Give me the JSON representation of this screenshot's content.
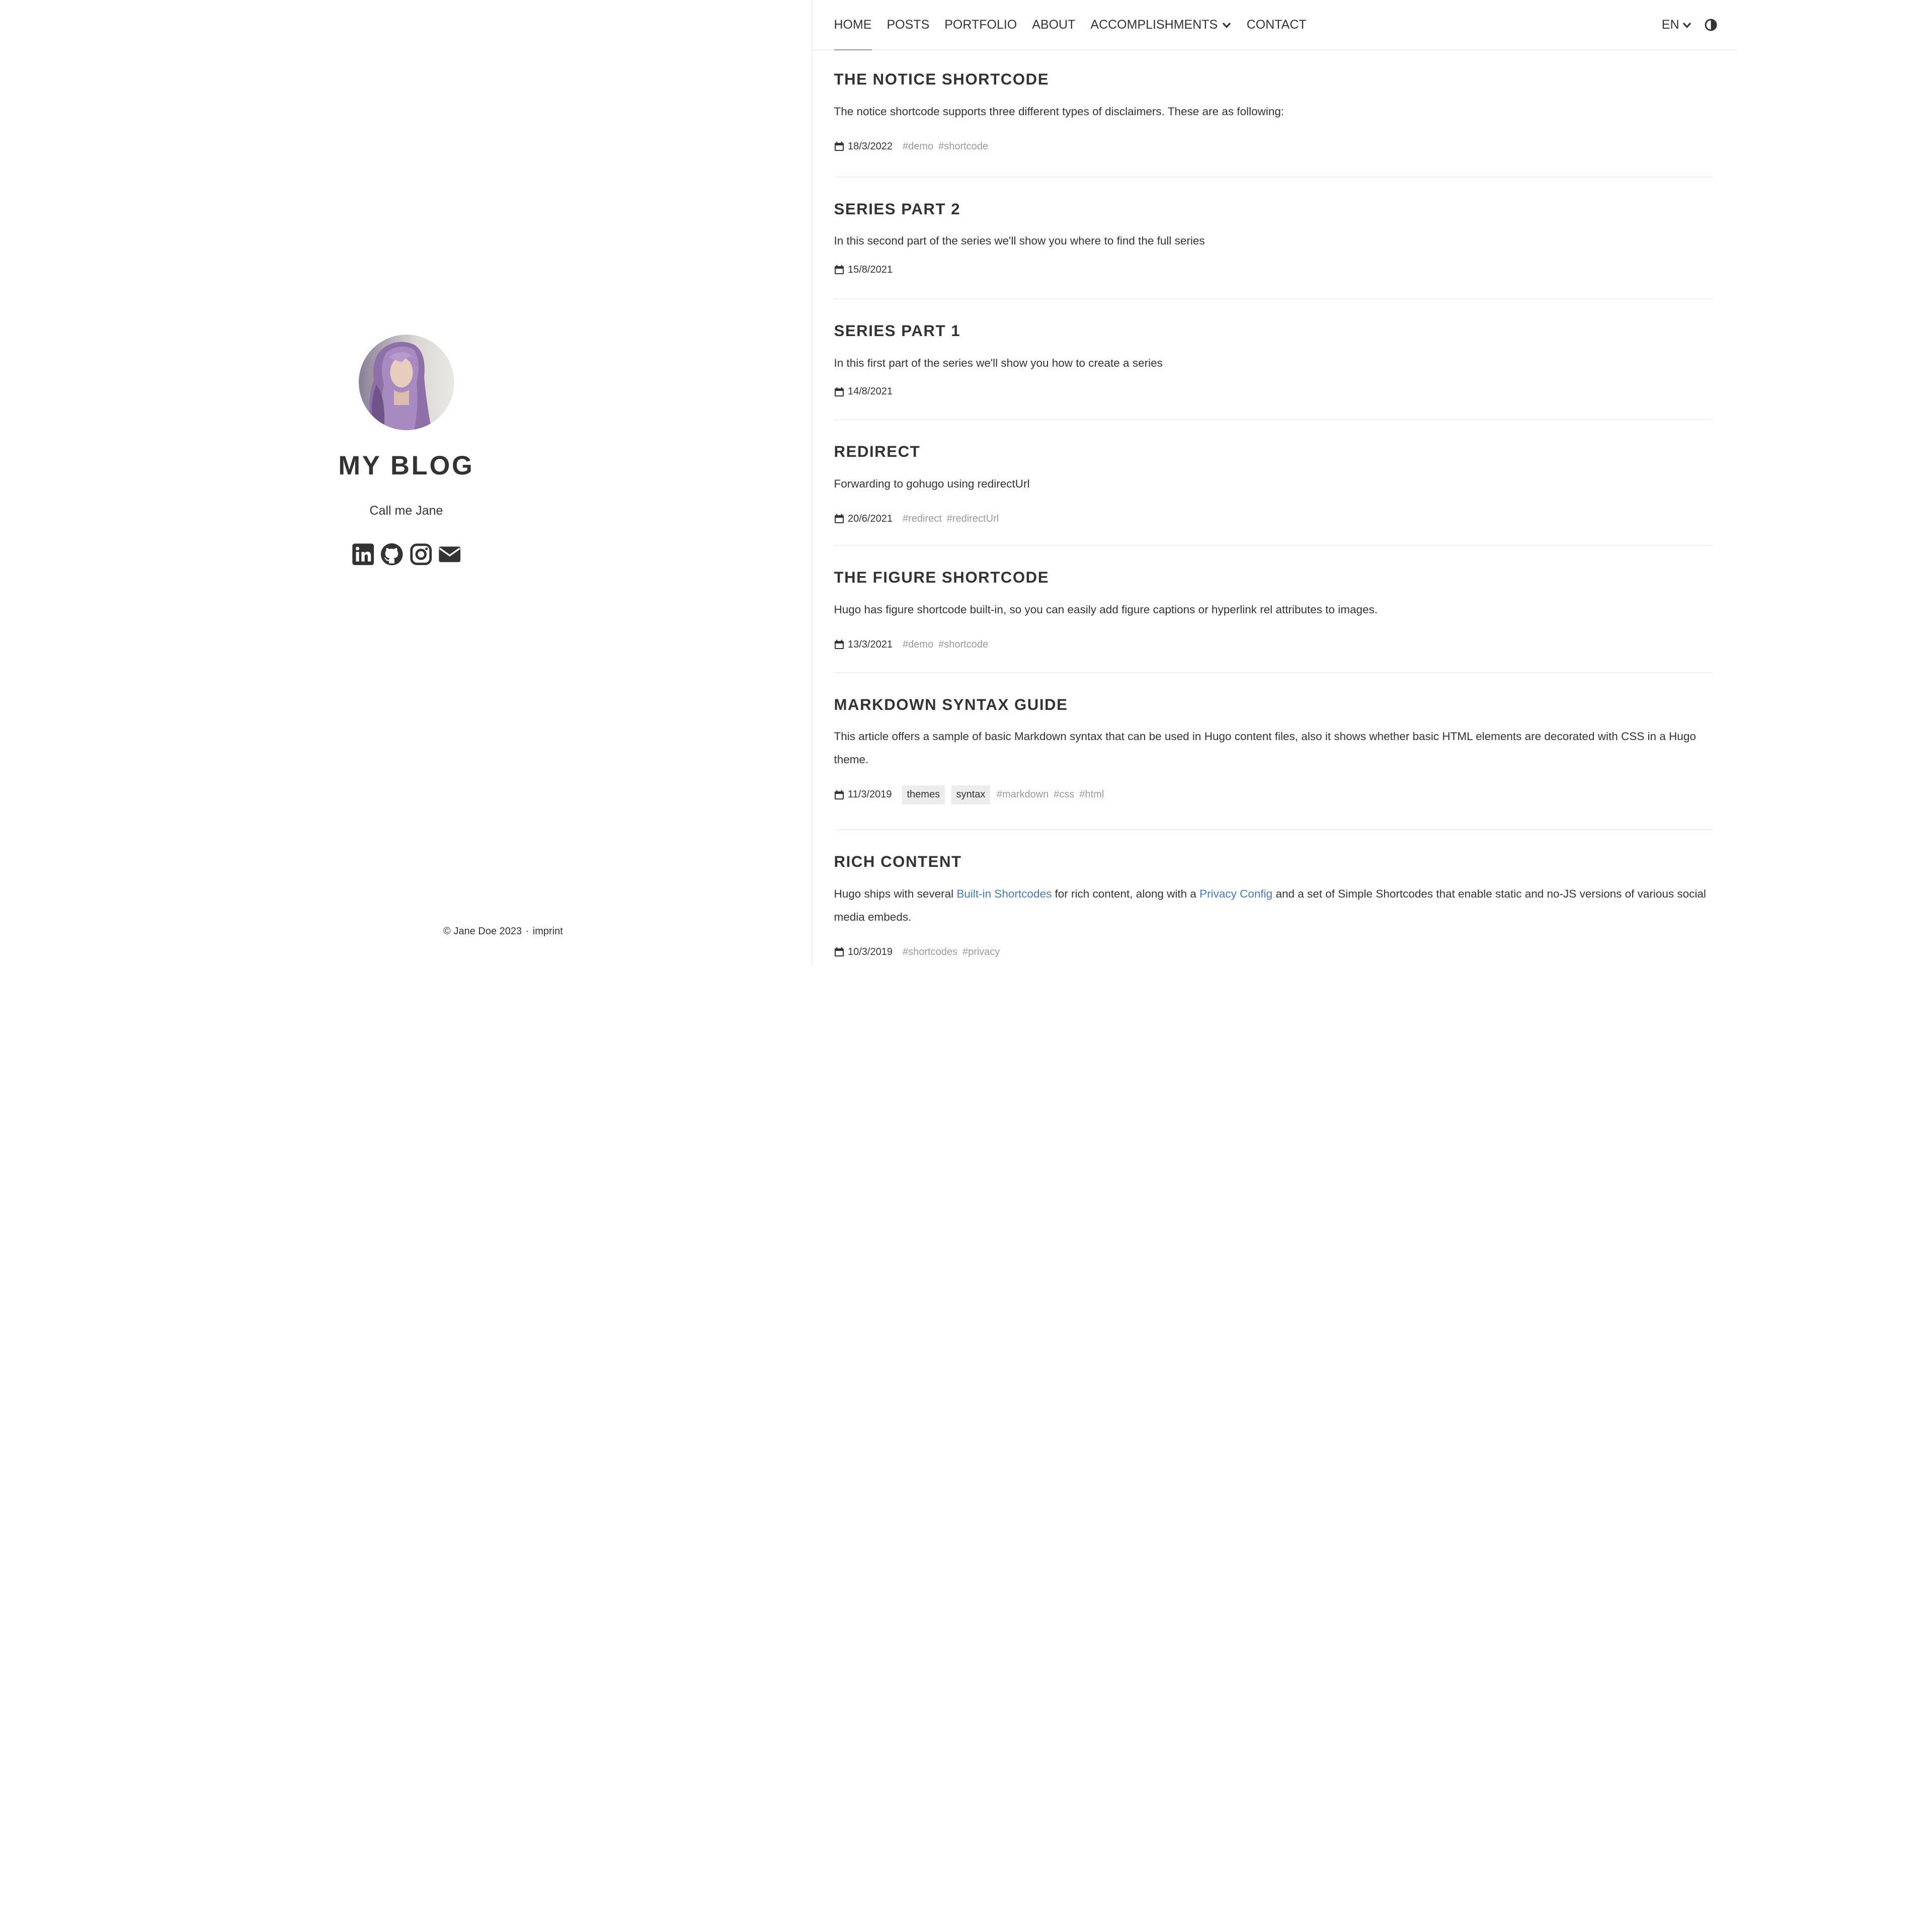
{
  "sidebar": {
    "site_title": "MY BLOG",
    "tagline": "Call me Jane",
    "socials": [
      {
        "name": "linkedin",
        "icon": "linkedin-icon"
      },
      {
        "name": "github",
        "icon": "github-icon"
      },
      {
        "name": "instagram",
        "icon": "instagram-icon"
      },
      {
        "name": "email",
        "icon": "envelope-icon"
      }
    ],
    "footer": {
      "copyright": "© Jane Doe 2023",
      "separator": "·",
      "imprint": "imprint"
    }
  },
  "nav": {
    "items": [
      {
        "label": "HOME",
        "active": true
      },
      {
        "label": "POSTS"
      },
      {
        "label": "PORTFOLIO"
      },
      {
        "label": "ABOUT"
      },
      {
        "label": "ACCOMPLISHMENTS",
        "dropdown": true
      },
      {
        "label": "CONTACT"
      }
    ],
    "language": "EN",
    "theme_toggle_icon": "contrast-icon"
  },
  "posts": [
    {
      "title": "THE NOTICE SHORTCODE",
      "summary": "The notice shortcode supports three different types of disclaimers. These are as following:",
      "date": "18/3/2022",
      "categories": [],
      "tags": [
        "#demo",
        "#shortcode"
      ]
    },
    {
      "title": "SERIES PART 2",
      "summary": "In this second part of the series we'll show you where to find the full series",
      "date": "15/8/2021",
      "categories": [],
      "tags": []
    },
    {
      "title": "SERIES PART 1",
      "summary": "In this first part of the series we'll show you how to create a series",
      "date": "14/8/2021",
      "categories": [],
      "tags": []
    },
    {
      "title": "REDIRECT",
      "summary": "Forwarding to gohugo using redirectUrl",
      "date": "20/6/2021",
      "categories": [],
      "tags": [
        "#redirect",
        "#redirectUrl"
      ]
    },
    {
      "title": "THE FIGURE SHORTCODE",
      "summary": "Hugo has figure shortcode built-in, so you can easily add figure captions or hyperlink rel attributes to images.",
      "date": "13/3/2021",
      "categories": [],
      "tags": [
        "#demo",
        "#shortcode"
      ]
    },
    {
      "title": "MARKDOWN SYNTAX GUIDE",
      "summary": "This article offers a sample of basic Markdown syntax that can be used in Hugo content files, also it shows whether basic HTML elements are decorated with CSS in a Hugo theme.",
      "date": "11/3/2019",
      "categories": [
        "themes",
        "syntax"
      ],
      "tags": [
        "#markdown",
        "#css",
        "#html"
      ]
    },
    {
      "title": "RICH CONTENT",
      "summary_parts": {
        "p1": "Hugo ships with several ",
        "link1": "Built-in Shortcodes",
        "p2": " for rich content, along with a ",
        "link2": "Privacy Config",
        "p3": " and a set of Simple Shortcodes that enable static and no-JS versions of various social media embeds."
      },
      "date": "10/3/2019",
      "categories": [],
      "tags": [
        "#shortcodes",
        "#privacy"
      ]
    }
  ],
  "colors": {
    "text": "#333333",
    "link": "#4a78b0",
    "tag": "#999999",
    "category_bg": "#ececec",
    "divider": "#f0f0f0"
  }
}
